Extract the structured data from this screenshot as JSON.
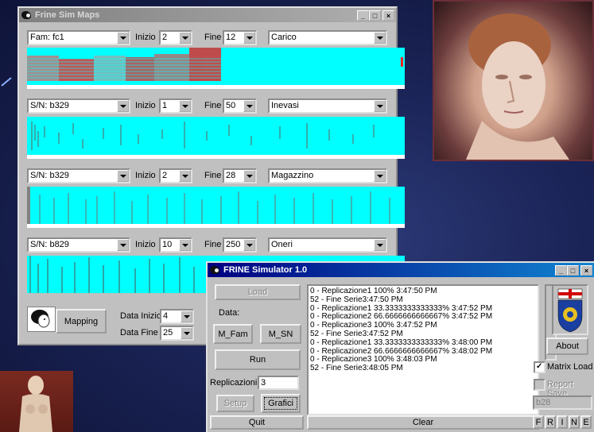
{
  "maps_window": {
    "title": "Frine Sim Maps",
    "rows": [
      {
        "series": "Fam: fc1",
        "inizio_label": "Inizio",
        "inizio": "2",
        "fine_label": "Fine",
        "fine": "12",
        "metric": "Carico"
      },
      {
        "series": "S/N: b329",
        "inizio_label": "Inizio",
        "inizio": "1",
        "fine_label": "Fine",
        "fine": "50",
        "metric": "Inevasi"
      },
      {
        "series": "S/N: b329",
        "inizio_label": "Inizio",
        "inizio": "2",
        "fine_label": "Fine",
        "fine": "28",
        "metric": "Magazzino"
      },
      {
        "series": "S/N: b829",
        "inizio_label": "Inizio",
        "inizio": "10",
        "fine_label": "Fine",
        "fine": "250",
        "metric": "Oneri"
      }
    ],
    "mapping_label": "Mapping",
    "data_inizio_label": "Data Inizio",
    "data_inizio": "4",
    "data_fine_label": "Data Fine",
    "data_fine": "25"
  },
  "sim_window": {
    "title": "FRINE Simulator 1.0",
    "load_label": "Load",
    "data_label": "Data:",
    "m_fam_label": "M_Fam",
    "m_sn_label": "M_SN",
    "run_label": "Run",
    "replicazioni_label": "Replicazioni",
    "replicazioni": "3",
    "setup_label": "Setup",
    "grafici_label": "Grafici",
    "quit_label": "Quit",
    "clear_label": "Clear",
    "about_label": "About",
    "matrix_load_label": "Matrix Load",
    "matrix_load_checked": true,
    "report_save_label": "Report Save",
    "report_save_checked": false,
    "filename": "b28",
    "frine_letters": [
      "F",
      "R",
      "I",
      "N",
      "E"
    ],
    "log_lines": [
      "0 - Replicazione1 100% 3:47:50 PM",
      "52 - Fine Serie3:47:50 PM",
      "0 - Replicazione1 33.3333333333333% 3:47:52 PM",
      "0 - Replicazione2 66.6666666666667% 3:47:52 PM",
      "0 - Replicazione3 100% 3:47:52 PM",
      "52 - Fine Serie3:47:52 PM",
      "0 - Replicazione1 33.3333333333333% 3:48:00 PM",
      "0 - Replicazione2 66.6666666666667% 3:48:02 PM",
      "0 - Replicazione3 100% 3:48:03 PM",
      "52 - Fine Serie3:48:05 PM"
    ]
  },
  "colors": {
    "map_background": "#00ffff",
    "map_hot": "#ff0000",
    "map_mark": "#6b6b6b",
    "title_active": "#000080",
    "title_inactive": "#808080"
  }
}
